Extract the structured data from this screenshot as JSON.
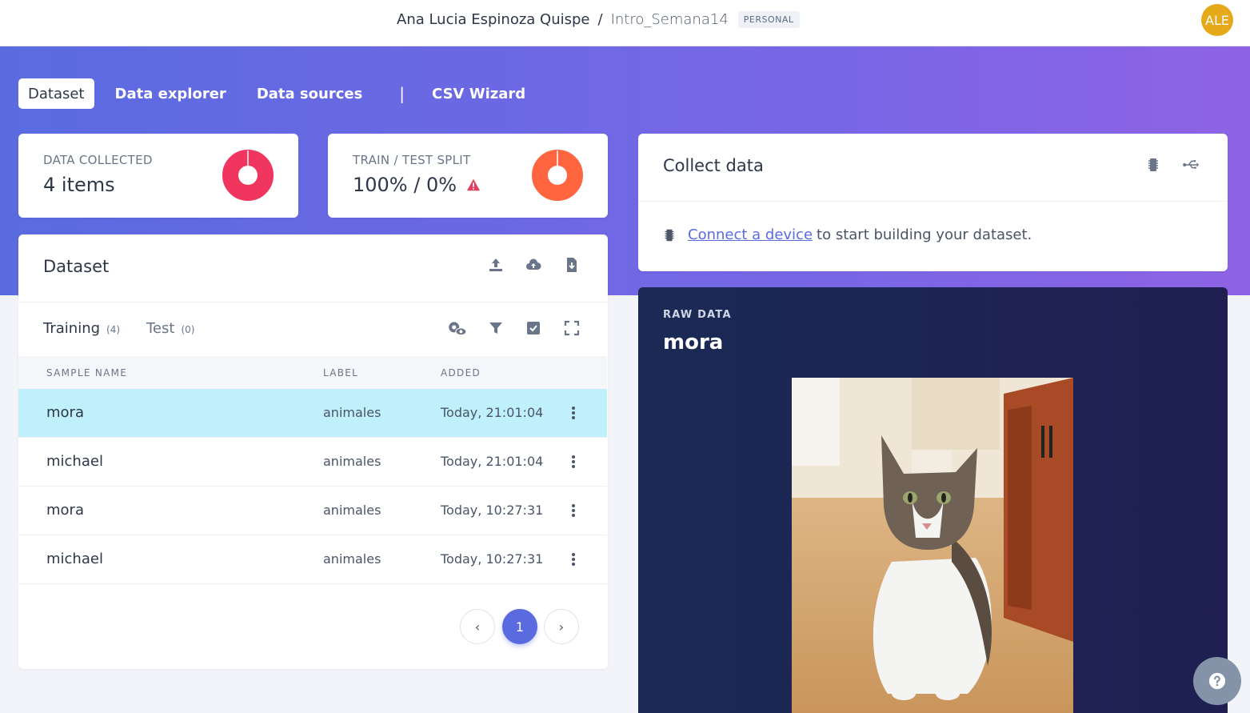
{
  "header": {
    "owner": "Ana Lucia Espinoza Quispe",
    "separator": "/",
    "project": "Intro_Semana14",
    "badge": "PERSONAL",
    "avatar_initials": "ALE"
  },
  "tabs": [
    {
      "label": "Dataset",
      "active": true
    },
    {
      "label": "Data explorer",
      "active": false
    },
    {
      "label": "Data sources",
      "active": false
    },
    {
      "label": "CSV Wizard",
      "active": false
    }
  ],
  "tab_divider": "|",
  "stats": {
    "data_collected": {
      "label": "DATA COLLECTED",
      "value": "4 items",
      "color": "#f0365f"
    },
    "split": {
      "label": "TRAIN / TEST SPLIT",
      "value": "100% / 0%",
      "color": "#ff6640",
      "warning_icon": "warning-triangle-icon",
      "warning_color": "#e53e5c"
    }
  },
  "dataset": {
    "title": "Dataset",
    "icons": [
      "upload-icon",
      "cloud-upload-icon",
      "file-download-icon"
    ],
    "subtabs": [
      {
        "label": "Training",
        "count": "(4)"
      },
      {
        "label": "Test",
        "count": "(0)"
      }
    ],
    "tool_icons": [
      "settings-eye-icon",
      "filter-icon",
      "check-square-icon",
      "fullscreen-icon"
    ],
    "columns": {
      "name": "SAMPLE NAME",
      "label": "LABEL",
      "added": "ADDED"
    },
    "rows": [
      {
        "name": "mora",
        "label": "animales",
        "added": "Today, 21:01:04",
        "selected": true
      },
      {
        "name": "michael",
        "label": "animales",
        "added": "Today, 21:01:04",
        "selected": false
      },
      {
        "name": "mora",
        "label": "animales",
        "added": "Today, 10:27:31",
        "selected": false
      },
      {
        "name": "michael",
        "label": "animales",
        "added": "Today, 10:27:31",
        "selected": false
      }
    ],
    "pagination": {
      "prev": "‹",
      "current": "1",
      "next": "›"
    }
  },
  "collect": {
    "title": "Collect data",
    "icons": [
      "device-chip-icon",
      "usb-icon"
    ],
    "link_text": "Connect a device",
    "rest_text": "to start building your dataset."
  },
  "raw": {
    "label": "RAW DATA",
    "name": "mora",
    "image": "cat-photo"
  },
  "help_icon": "question-icon",
  "accent": "#5a6be0"
}
